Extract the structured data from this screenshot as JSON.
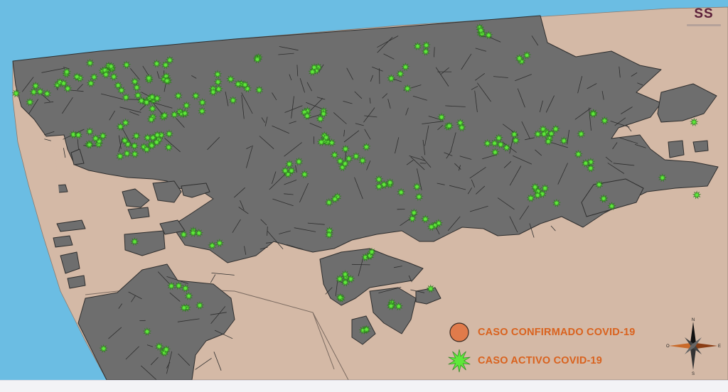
{
  "logo": {
    "text": "SS"
  },
  "legend": {
    "confirmed": {
      "label": "CASO CONFIRMADO COVID-19",
      "color": "#e07b4b"
    },
    "active": {
      "label": "CASO ACTIVO COVID-19",
      "color": "#5ee83a"
    }
  },
  "compass": {
    "north": "N",
    "south": "S",
    "east": "E",
    "west": "O"
  },
  "colors": {
    "sea": "#6bbde3",
    "land": "#d4b9a6",
    "blocks": "#6e6e6e",
    "block_border": "#2e2e2e",
    "label_text": "#d9621e"
  }
}
